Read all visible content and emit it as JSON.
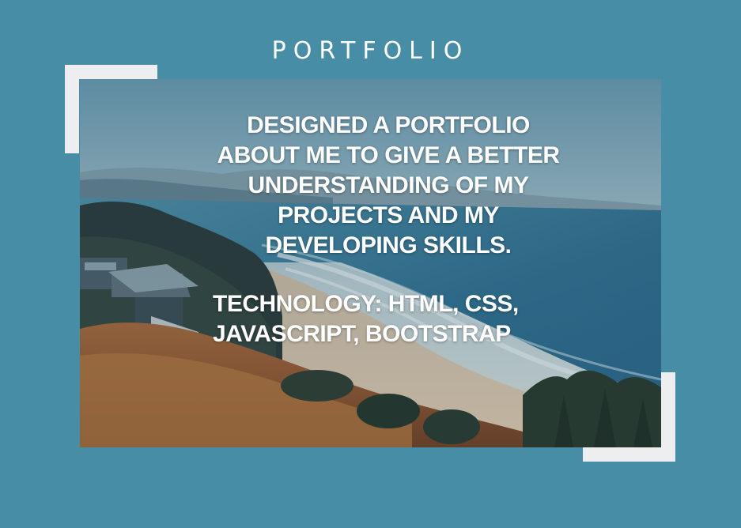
{
  "page": {
    "title": "PORTFOLIO"
  },
  "project": {
    "description": "DESIGNED A PORTFOLIO ABOUT ME TO GIVE A BETTER UNDERSTANDING OF MY PROJECTS AND MY DEVELOPING SKILLS.",
    "technology": "TECHNOLOGY: HTML, CSS, JAVASCRIPT, BOOTSTRAP",
    "image": "coastal-landscape-photo"
  },
  "colors": {
    "background": "#478da6",
    "bracket": "#eceeef",
    "text": "#ffffff"
  }
}
